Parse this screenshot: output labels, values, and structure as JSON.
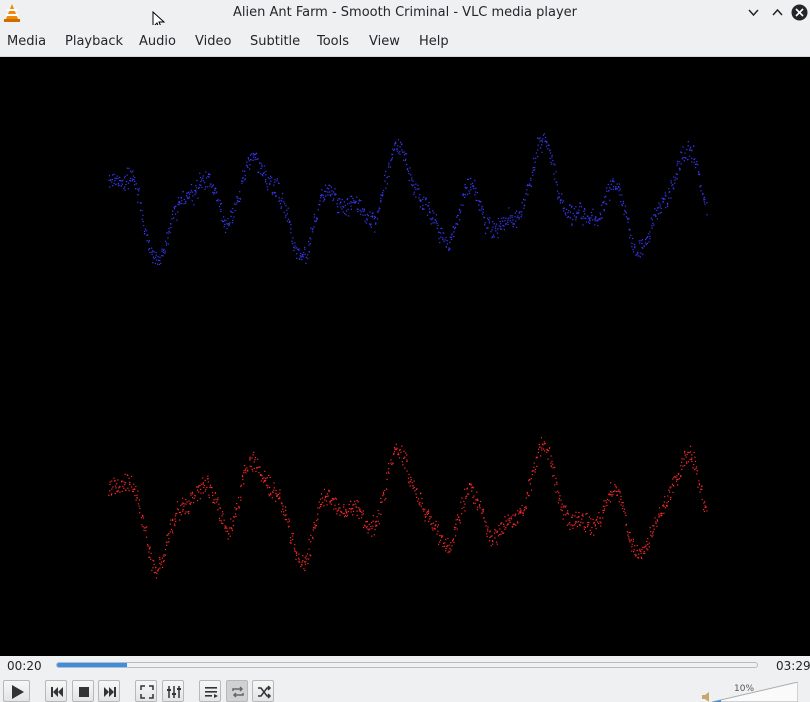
{
  "window": {
    "title": "Alien Ant Farm - Smooth Criminal - VLC media player"
  },
  "menu": [
    "Media",
    "Playback",
    "Audio",
    "Video",
    "Subtitle",
    "Tools",
    "View",
    "Help"
  ],
  "player": {
    "elapsed": "00:20",
    "total": "03:29",
    "progress": 0.1,
    "volume": "10%"
  },
  "colors": {
    "left_channel": "#3a3aff",
    "right_channel": "#ff2a2a",
    "seek_fill": "#3d8ee0"
  },
  "icons": [
    "vlc-cone-icon",
    "minimize-icon",
    "maximize-icon",
    "close-icon",
    "play-icon",
    "previous-icon",
    "stop-icon",
    "next-icon",
    "fullscreen-icon",
    "extended-settings-icon",
    "playlist-icon",
    "loop-icon",
    "shuffle-icon",
    "speaker-icon"
  ]
}
